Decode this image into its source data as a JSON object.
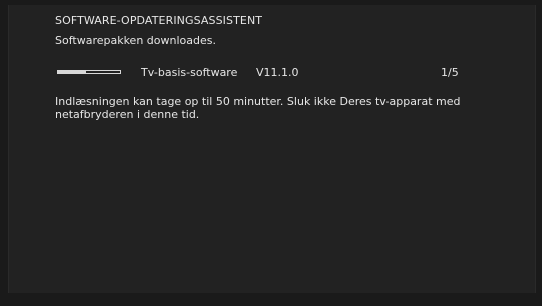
{
  "assistant": {
    "title": "SOFTWARE-OPDATERINGSASSISTENT",
    "status": "Softwarepakken downloades."
  },
  "package": {
    "name": "Tv-basis-software",
    "version": "V11.1.0",
    "count": "1/5",
    "progress_fraction": 0.45
  },
  "notice": "Indlæsningen kan tage op til 50 minutter. Sluk ikke Deres tv-apparat med netafbryderen i denne tid.",
  "colors": {
    "background": "#222222",
    "text": "#e6e6e6",
    "progress": "#d8d8d8"
  }
}
